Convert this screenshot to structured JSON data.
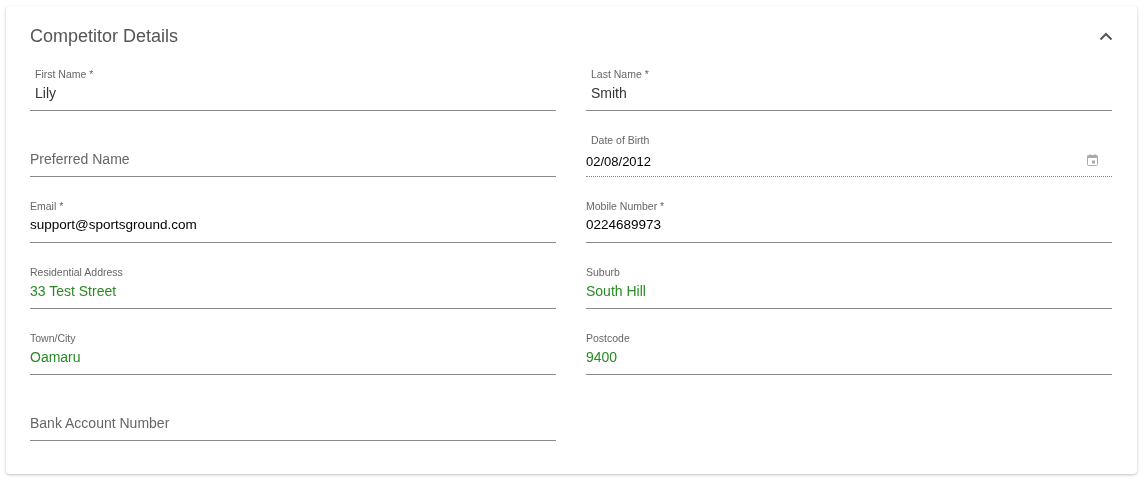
{
  "panel": {
    "title": "Competitor Details",
    "expanded": true
  },
  "rows": [
    {
      "fields": [
        {
          "kind": "filled",
          "label": "First Name *",
          "value": "Lily"
        },
        {
          "kind": "filled",
          "label": "Last Name *",
          "value": "Smith"
        }
      ]
    },
    {
      "fields": [
        {
          "kind": "empty",
          "placeholder": "Preferred Name"
        },
        {
          "kind": "date",
          "label": "Date of Birth",
          "value": "02/08/2012"
        }
      ]
    },
    {
      "fields": [
        {
          "kind": "autofill",
          "label": "Email *",
          "value": "support@sportsground.com"
        },
        {
          "kind": "autofill",
          "label": "Mobile Number *",
          "value": "0224689973"
        }
      ]
    },
    {
      "fields": [
        {
          "kind": "verified",
          "label": "Residential Address",
          "value": "33 Test Street"
        },
        {
          "kind": "verified",
          "label": "Suburb",
          "value": "South Hill"
        }
      ]
    },
    {
      "fields": [
        {
          "kind": "verified",
          "label": "Town/City",
          "value": "Oamaru"
        },
        {
          "kind": "verified",
          "label": "Postcode",
          "value": "9400"
        }
      ]
    },
    {
      "fields": [
        {
          "kind": "empty",
          "placeholder": "Bank Account Number"
        }
      ]
    }
  ]
}
